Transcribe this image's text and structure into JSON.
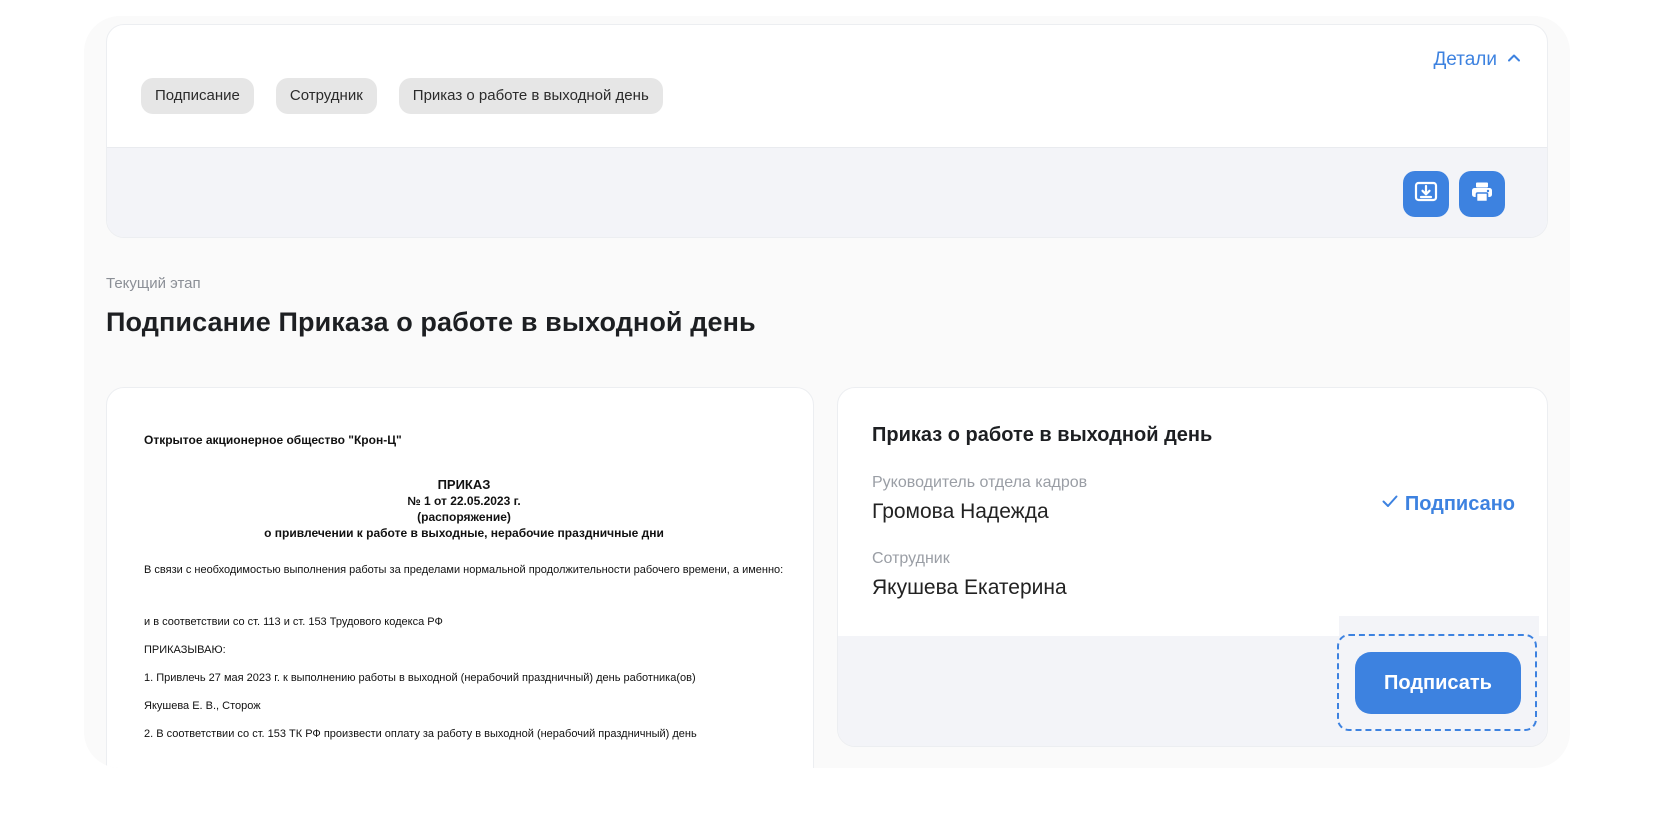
{
  "header": {
    "chips": [
      "Подписание",
      "Сотрудник",
      "Приказ о работе в выходной день"
    ],
    "details_label": "Детали"
  },
  "toolbar": {
    "download_icon": "download-icon",
    "print_icon": "print-icon"
  },
  "stage": {
    "label": "Текущий этап",
    "title": "Подписание Приказа о работе в выходной день"
  },
  "document": {
    "company": "Открытое акционерное общество \"Крон-Ц\"",
    "heading": "ПРИКАЗ",
    "number_line": "№ 1 от 22.05.2023 г.",
    "type_line": "(распоряжение)",
    "subject_line": "о привлечении к работе в выходные, нерабочие праздничные дни",
    "para1": "В связи с необходимостью выполнения работы за пределами нормальной продолжительности рабочего времени, а именно:",
    "para2": "и в соответствии со ст. 113 и ст. 153 Трудового кодекса РФ",
    "para3": "ПРИКАЗЫВАЮ:",
    "para4": "1. Привлечь 27 мая 2023 г. к выполнению работы в выходной (нерабочий праздничный) день  работника(ов)",
    "para5": "Якушева Е. В., Сторож",
    "para6": "2. В соответствии со ст. 153 ТК РФ произвести оплату за работу в выходной (нерабочий праздничный)  день"
  },
  "signing": {
    "title": "Приказ о работе в выходной день",
    "signers": [
      {
        "role": "Руководитель отдела кадров",
        "name": "Громова Надежда",
        "status": "Подписано"
      },
      {
        "role": "Сотрудник",
        "name": "Якушева Екатерина"
      }
    ],
    "sign_button": "Подписать"
  },
  "colors": {
    "accent": "#3d82e0",
    "chip_bg": "#e6e6e6",
    "panel_bg": "#f3f4f8"
  }
}
